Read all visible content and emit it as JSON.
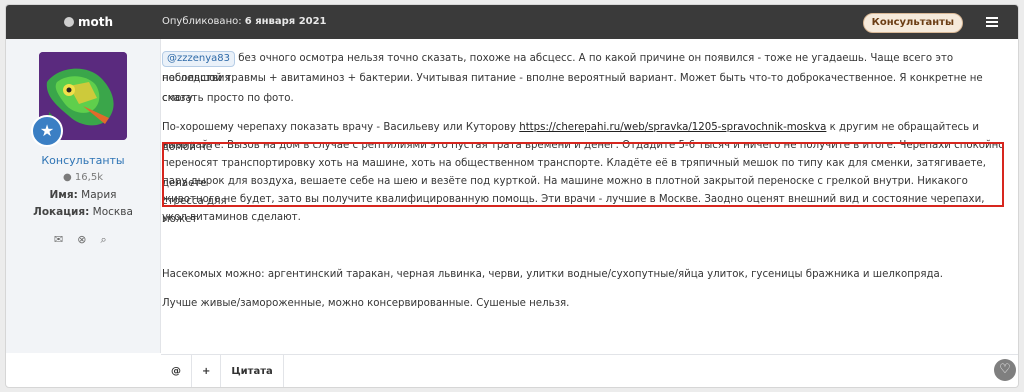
{
  "header": {
    "author": "moth",
    "date_prefix": "Опубликовано:",
    "date": "6 января 2021",
    "badge": "Консультанты"
  },
  "author": {
    "role": "Консультанты",
    "reputation": "16,5k",
    "name_label": "Имя:",
    "name_value": "Мария",
    "location_label": "Локация:",
    "location_value": "Москва"
  },
  "post": {
    "mention": "@zzzenya83",
    "p1_line1": " без очного осмотра нельзя точно сказать, похоже на абсцесс. А по какой причине он появился - тоже не угадаешь. Чаще всего это последствия",
    "p1_line2": "небольшой травмы + авитаминоз + бактерии. Учитывая питание - вполне вероятный вариант. Может быть что-то доброкачественное. Я конкретне не смогу",
    "p1_line3": "сказать просто по фото.",
    "p2_line1_pre": "По-хорошему черепаху показать врачу - Васильеву или Куторову ",
    "p2_link": "https://cherepahi.ru/web/spravka/1205-spravochnik-moskva",
    "p2_line1_post": " к другим не обращайтесь и домой не",
    "p2_line2": "вызывайте. Вызов на дом в случае с рептилиями это пустая трата времени и денег. Отдадите 5-6 тысяч и ничего не получите в итоге. Черепахи спокойно",
    "p2_line3": "переносят транспортировку хоть на машине, хоть на общественном транспорте. Кладёте её в тряпичный мешок по типу как для сменки, затягиваете, делаете",
    "p2_line4": "пару дырок для воздуха, вешаете себе на шею и везёте под курткой. На машине можно в плотной закрытой переноске с грелкой внутри. Никакого стресса для",
    "p2_line5": "животного не будет, зато вы получите квалифицированную помощь. Эти врачи - лучшие в Москве. Заодно оценят внешний вид и состояние черепахи, может",
    "p2_line6": "укол витаминов сделают.",
    "p3": "Насекомых можно: аргентинский таракан, черная львинка, черви, улитки водные/сухопутные/яйца улиток, гусеницы бражника и шелкопряда.",
    "p4": "Лучше живые/замороженные, можно консервированные. Сушеные нельзя."
  },
  "toolbar": {
    "quote_label": "Цитата"
  },
  "colors": {
    "header_bg": "#3a3a3a",
    "link": "#2e74b5",
    "highlight": "#d7261e"
  }
}
